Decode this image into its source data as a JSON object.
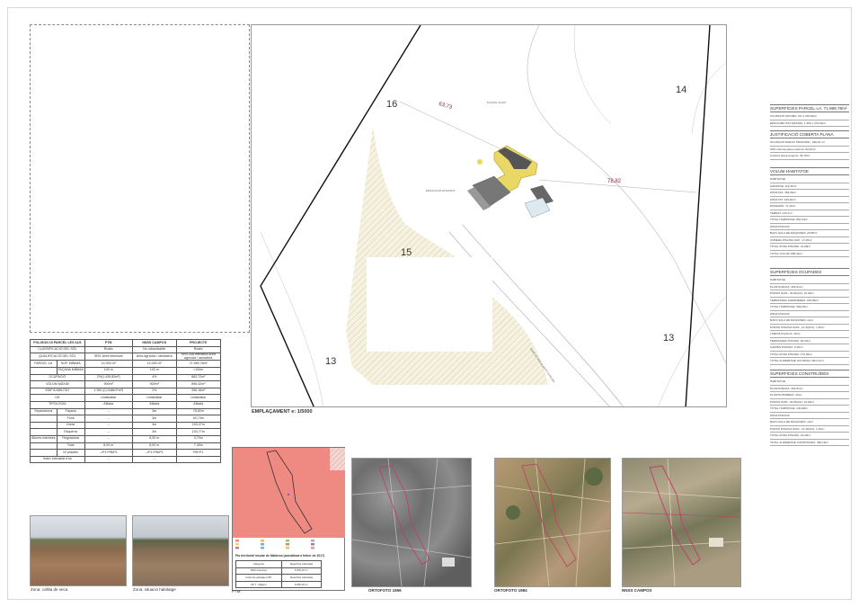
{
  "plan": {
    "parcel_labels": [
      "16",
      "14",
      "15",
      "13",
      "13"
    ],
    "distance_labels": [
      "63,73",
      "78,82"
    ],
    "small_notes": [
      "PLANOL ALZAT",
      "EDIFICACIÓ EXISTENT",
      "CAMÍ DE SON ALBERTÍ A PALMA"
    ],
    "caption": "EMPLAÇAMENT  e: 1/5000"
  },
  "params_table": {
    "headers": [
      "POLIGON 15 PARCEL·LES 61/6",
      "PTM",
      "NNSS CAMPOS",
      "PROJECTE"
    ],
    "rows": [
      [
        "CLASSIFICACIÓ DEL SÒL",
        "",
        "Rústic",
        "No urbanitzable",
        "Rústic"
      ],
      [
        "QUALIFICACIÓ DEL SÒL",
        "",
        "SRG  Àrea intensiva",
        "Àrea agrícola / ramadera",
        "SRG  AIA intensiva  Àrea agrícola / ramadera"
      ],
      [
        "PARCEL·LA",
        "SUP. MÍNIMA",
        "14.000 m²",
        "14.000 m²",
        "71.989,78m²"
      ],
      [
        "",
        "FAÇANA MÍNIMA",
        "100 m",
        "100 m",
        ">100m"
      ],
      [
        "OCUPACIÓ",
        "",
        "2%(1.439,82m²)",
        "4%",
        "683,72m²"
      ],
      [
        "VOLUM MÀXIM",
        "",
        "900m³",
        "900m³",
        "896,42m³"
      ],
      [
        "EDIFICABILITAT",
        "",
        "1.350 (0,0188m²/m²)",
        "2%",
        "356,16m²"
      ],
      [
        "ÚS",
        "",
        "Unifamiliar",
        "Unifamiliar",
        "Unifamiliar"
      ],
      [
        "TIPOLOGIA",
        "",
        "Aïllada",
        "Aïllada",
        "Aïllada"
      ],
      [
        "Separacions",
        "Façana",
        "--",
        "3m",
        "78,82m"
      ],
      [
        "",
        "Fons",
        "--",
        "3m",
        "63,73m"
      ],
      [
        "",
        "Dreta",
        "--",
        "3m",
        "153,07m"
      ],
      [
        "",
        "Esquerra",
        "--",
        "3m",
        "103,77m"
      ],
      [
        "Altures màximes",
        "Reguladora",
        "--",
        "6,00 m",
        "3,70m"
      ],
      [
        "",
        "Total",
        "8,00 m",
        "8,00 m",
        "7,45m"
      ],
      [
        "",
        "Nº plantes",
        "--/P1+PB/P1",
        "--/P1+PB/P1",
        "PB+P1"
      ],
      [
        "Índex intensitat d'ús",
        "",
        "--",
        "--",
        "--"
      ]
    ]
  },
  "right_panel": {
    "sections": [
      {
        "title": "SUPERFÍCIES PARCEL·LA: 71.989,78m²",
        "lines": [
          "OCUPACIÓ MÀXIMA: 2% 1.439,82m²",
          "EDIFICABILITAT MÀXIMA: 1.350  1.379,52m²"
        ]
      },
      {
        "title": "JUSTIFICACIÓ COBERTA PLANA",
        "lines": [
          "OCUPACIÓ EDIFICI PRINCIPAL: 248,22 m²",
          "30% coberta plana màxima: 84,06m²",
          "Coberta plana projecte: 36,79m²"
        ]
      },
      {
        "title": "VOLUM HABITATGE",
        "lines": [
          "HABITATGE",
          "GARATGE: 112,30m³",
          "ZONA DIA: 356,36m³",
          "ZONA NIT: 225,30m³",
          "PASSADÍS: 71,40m³",
          "TERRAT: 146,1m³",
          "TOTAL HABITATGE: 851,54m³",
          "ZONA PISCINA",
          "BANY-SALA DE MÀQUINES: 26,88m³",
          "VORERA PISCINA SUP.: 17,26m³",
          "TOTAL ZONA PISCINA: 44,88m³",
          "TOTAL VOLUM: 896,42m³"
        ]
      },
      {
        "title": "SUPERFÍCIES OCUPADES",
        "lines": [
          "HABITATGE",
          "PLANTA BAIXA: 262,81m²",
          "PORXO SUPL. 33,86(1/2): 16,93m²",
          "TERRASSES JARDINERES: 229,95m²",
          "TOTAL HABITATGE: 509,69m²",
          "ZONA PISCINA",
          "BANY-SALA DE MÀQUINES: 12m²",
          "PORXO PISCINA SUPL. 14,40(1/2): 7,20m²",
          "LÀMINA D'AIGUA: 36m²",
          "TERRASSES PISCINA: 93,93m²",
          "CAMINS PISCINA: 6,00m²",
          "TOTAL ZONA PISCINA: 174,03m²",
          "TOTAL SUPERFÍCIE OCUPADA: 683,72m²"
        ]
      },
      {
        "title": "SUPERFÍCIES CONSTRUÏDES",
        "lines": [
          "HABITATGE",
          "PLANTA BAIXA: 262,81m²",
          "PLANTA PRIMERA: 43m²",
          "PORXO SUPL. 33,86(1/2): 16,93m²",
          "TOTAL HABITATGE: 340,88m²",
          "ZONA PISCINA",
          "BANY-SALA DE MÀQUINES: 12m²",
          "PORXO PISCINA SUPL. 14,40(1/2): 7,20m²",
          "TOTAL ZONA PISCINA: 19,20m²",
          "TOTAL SUPERFÍCIE CONSTRUÏDA: 360,16m²"
        ]
      }
    ]
  },
  "photos": {
    "photo1_caption": "Zona: collita de seca",
    "photo2_caption": "Zona: situació habitatge",
    "ptm_caption": "PTM",
    "ptm_map_title": "Pla territorial insular de Mallorca (actualitzat a febrer de 2017)",
    "ptm_table": {
      "headers": [
        "Categoria",
        "Superfície calculada"
      ],
      "rows": [
        [
          "SRG Intensiva",
          "9.305,19 m²"
        ]
      ],
      "headers2": [
        "Unitat de paisatge (UP)",
        "Superfície calculada"
      ],
      "rows2": [
        [
          "UP 7 - Migjorn",
          "9.305,19 m²"
        ]
      ]
    },
    "orto1_caption": "ORTOFOTO  1956",
    "orto2_caption": "ORTOFOTO  1984",
    "nnss_caption": "NNSS CAMPOS"
  },
  "colors": {
    "ptm_fill": "#ef8a82",
    "hatch": "#d9cfa6",
    "pink_line": "#c23a66"
  }
}
